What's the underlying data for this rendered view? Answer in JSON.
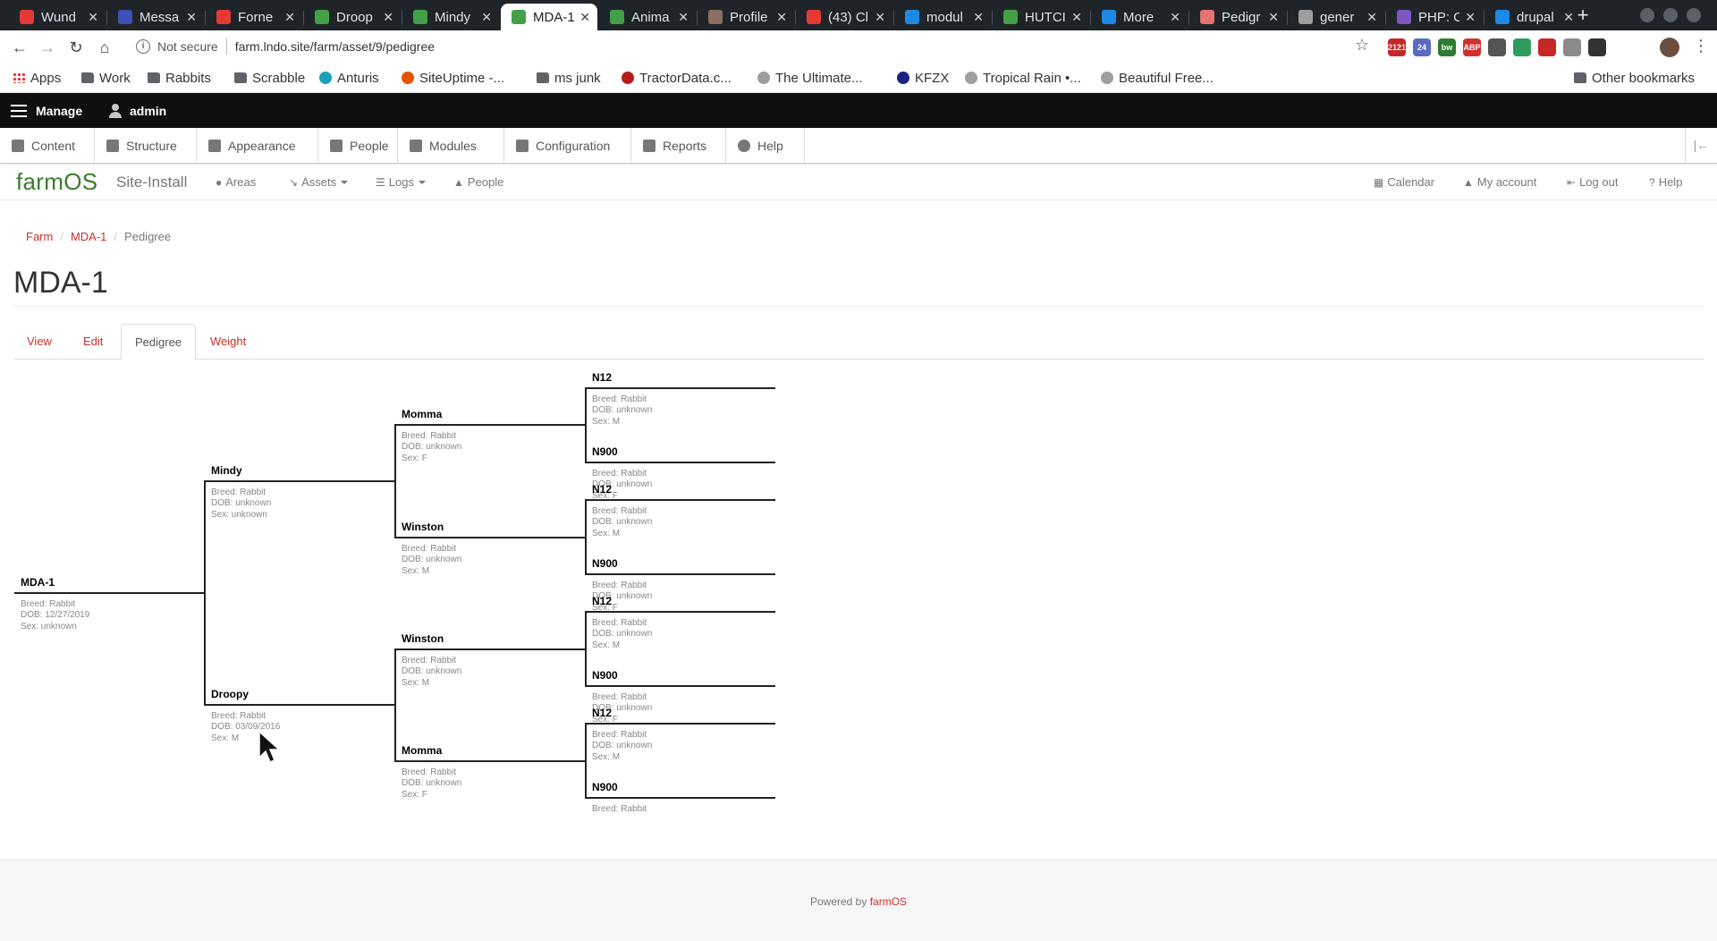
{
  "browser": {
    "tabs": [
      {
        "title": "Wund",
        "icon": "wunderground-icon",
        "color": "#e53935"
      },
      {
        "title": "Messa",
        "icon": "messages-icon",
        "color": "#3f51b5"
      },
      {
        "title": "Forne",
        "icon": "wunderground-icon",
        "color": "#e53935"
      },
      {
        "title": "Droop",
        "icon": "farmos-leaf-icon",
        "color": "#43a047"
      },
      {
        "title": "Mindy",
        "icon": "farmos-leaf-icon",
        "color": "#43a047"
      },
      {
        "title": "MDA-1",
        "icon": "farmos-leaf-icon",
        "color": "#43a047"
      },
      {
        "title": "Anima",
        "icon": "farmos-leaf-icon",
        "color": "#43a047"
      },
      {
        "title": "Profile",
        "icon": "profile-icon",
        "color": "#8d6e63"
      },
      {
        "title": "(43) Cl",
        "icon": "youtube-icon",
        "color": "#e53935"
      },
      {
        "title": "modul",
        "icon": "drupal-icon",
        "color": "#1e88e5"
      },
      {
        "title": "HUTCI",
        "icon": "hutch-icon",
        "color": "#43a047"
      },
      {
        "title": "More",
        "icon": "chart-icon",
        "color": "#1e88e5"
      },
      {
        "title": "Pedigr",
        "icon": "pedigree-icon",
        "color": "#e57373"
      },
      {
        "title": "gener",
        "icon": "github-icon",
        "color": "#9e9e9e"
      },
      {
        "title": "PHP: C",
        "icon": "php-icon",
        "color": "#7e57c2"
      },
      {
        "title": "drupal",
        "icon": "drupal-icon",
        "color": "#1e88e5"
      }
    ],
    "active_tab": 5,
    "new_tab_label": "+",
    "security_label": "Not secure",
    "url": "farm.lndo.site/farm/asset/9/pedigree",
    "extensions": [
      "2121",
      "24",
      "bw",
      "ABP",
      "",
      "",
      "",
      "",
      ""
    ],
    "bookmarks": [
      {
        "label": "Apps",
        "icon": "apps-grid-icon"
      },
      {
        "label": "Work",
        "icon": "folder-icon"
      },
      {
        "label": "Rabbits",
        "icon": "folder-icon"
      },
      {
        "label": "Scrabble",
        "icon": "folder-icon"
      },
      {
        "label": "Anturis",
        "icon": "anturis-icon"
      },
      {
        "label": "SiteUptime -...",
        "icon": "siteuptime-icon"
      },
      {
        "label": "ms junk",
        "icon": "folder-icon"
      },
      {
        "label": "TractorData.c...",
        "icon": "tractordata-icon"
      },
      {
        "label": "The Ultimate...",
        "icon": "site-icon"
      },
      {
        "label": "KFZX",
        "icon": "kfzx-icon"
      },
      {
        "label": "Tropical Rain •...",
        "icon": "site-icon"
      },
      {
        "label": "Beautiful Free...",
        "icon": "site-icon"
      },
      {
        "label": "Other bookmarks",
        "icon": "folder-icon"
      }
    ]
  },
  "admin": {
    "manage_label": "Manage",
    "user_label": "admin",
    "tray": [
      "Content",
      "Structure",
      "Appearance",
      "People",
      "Modules",
      "Configuration",
      "Reports",
      "Help"
    ]
  },
  "farm_nav": {
    "brand": "farmOS",
    "site_name": "Site-Install",
    "left": [
      {
        "label": "Areas",
        "icon": "globe-icon",
        "dropdown": false
      },
      {
        "label": "Assets",
        "icon": "assets-icon",
        "dropdown": true
      },
      {
        "label": "Logs",
        "icon": "list-icon",
        "dropdown": true
      },
      {
        "label": "People",
        "icon": "person-icon",
        "dropdown": false
      }
    ],
    "right": [
      {
        "label": "Calendar",
        "icon": "calendar-icon"
      },
      {
        "label": "My account",
        "icon": "person-icon"
      },
      {
        "label": "Log out",
        "icon": "logout-icon"
      },
      {
        "label": "Help",
        "icon": "help-icon"
      }
    ]
  },
  "breadcrumb": [
    "Farm",
    "MDA-1",
    "Pedigree"
  ],
  "page_title": "MDA-1",
  "tabs": [
    "View",
    "Edit",
    "Pedigree",
    "Weight"
  ],
  "active_tab": "Pedigree",
  "pedigree": {
    "subject": {
      "name": "MDA-1",
      "breed": "Breed: Rabbit",
      "dob": "DOB: 12/27/2019",
      "sex": "Sex: unknown"
    },
    "parents": [
      {
        "name": "Mindy",
        "breed": "Breed: Rabbit",
        "dob": "DOB: unknown",
        "sex": "Sex: unknown"
      },
      {
        "name": "Droopy",
        "breed": "Breed: Rabbit",
        "dob": "DOB: 03/09/2016",
        "sex": "Sex: M"
      }
    ],
    "grandparents": [
      {
        "name": "Momma",
        "breed": "Breed: Rabbit",
        "dob": "DOB: unknown",
        "sex": "Sex: F"
      },
      {
        "name": "Winston",
        "breed": "Breed: Rabbit",
        "dob": "DOB: unknown",
        "sex": "Sex: M"
      },
      {
        "name": "Winston",
        "breed": "Breed: Rabbit",
        "dob": "DOB: unknown",
        "sex": "Sex: M"
      },
      {
        "name": "Momma",
        "breed": "Breed: Rabbit",
        "dob": "DOB: unknown",
        "sex": "Sex: F"
      }
    ],
    "great_grandparents": [
      {
        "name": "N12",
        "breed": "Breed: Rabbit",
        "dob": "DOB: unknown",
        "sex": "Sex: M"
      },
      {
        "name": "N900",
        "breed": "Breed: Rabbit",
        "dob": "DOB: unknown",
        "sex": "Sex: F"
      },
      {
        "name": "N12",
        "breed": "Breed: Rabbit",
        "dob": "DOB: unknown",
        "sex": "Sex: M"
      },
      {
        "name": "N900",
        "breed": "Breed: Rabbit",
        "dob": "DOB: unknown",
        "sex": "Sex: F"
      },
      {
        "name": "N12",
        "breed": "Breed: Rabbit",
        "dob": "DOB: unknown",
        "sex": "Sex: M"
      },
      {
        "name": "N900",
        "breed": "Breed: Rabbit",
        "dob": "DOB: unknown",
        "sex": "Sex: F"
      },
      {
        "name": "N12",
        "breed": "Breed: Rabbit",
        "dob": "DOB: unknown",
        "sex": "Sex: M"
      },
      {
        "name": "N900",
        "breed": "Breed: Rabbit",
        "dob": "",
        "sex": ""
      }
    ]
  },
  "footer": {
    "prefix": "Powered by",
    "link": "farmOS"
  }
}
